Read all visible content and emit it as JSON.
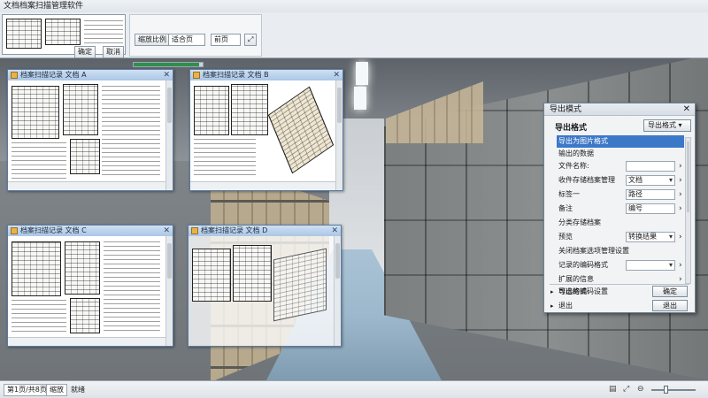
{
  "app": {
    "title": "文档档案扫描管理软件"
  },
  "toolbar": {
    "view_button": "缩放比例",
    "zoom_select": "适合页",
    "page_select": "前页",
    "fit_icon": "fit-screen-icon",
    "ok_button": "确定",
    "cancel_button": "取消",
    "progress": 0.95
  },
  "documents": [
    {
      "title": "档案扫描记录 文档 A"
    },
    {
      "title": "档案扫描记录 文档 B"
    },
    {
      "title": "档案扫描记录 文档 C"
    },
    {
      "title": "档案扫描记录 文档 D"
    }
  ],
  "export_dialog": {
    "title": "导出模式",
    "header_label": "导出格式",
    "header_button": "导出格式 ▾",
    "items": [
      {
        "label": "导出为图片格式",
        "selected": true
      },
      {
        "label": "输出的数据"
      },
      {
        "label": "文件名称:",
        "value": ""
      },
      {
        "label": "收件存储档案管理",
        "value": "文档"
      },
      {
        "label": "标签一",
        "value": "路径"
      },
      {
        "label": "备注",
        "value": "编号"
      },
      {
        "label": "分类存储档案"
      },
      {
        "label": "预览",
        "value": "转换结果"
      },
      {
        "label": "关闭档案选项管理设置"
      },
      {
        "label": "记录的编码格式",
        "value": ""
      },
      {
        "label": "扩展的信息"
      },
      {
        "label": "可选的编码设置"
      }
    ],
    "sections": [
      {
        "label": "导出格式",
        "button": "确定"
      },
      {
        "label": "退出",
        "button": "退出"
      }
    ],
    "colors": {
      "selected": "#3c78c8"
    }
  },
  "statusbar": {
    "page_info": "第1页/共8页",
    "zoom_button": "缩放",
    "mode_text": "就绪",
    "zoom_level": 0.3
  }
}
